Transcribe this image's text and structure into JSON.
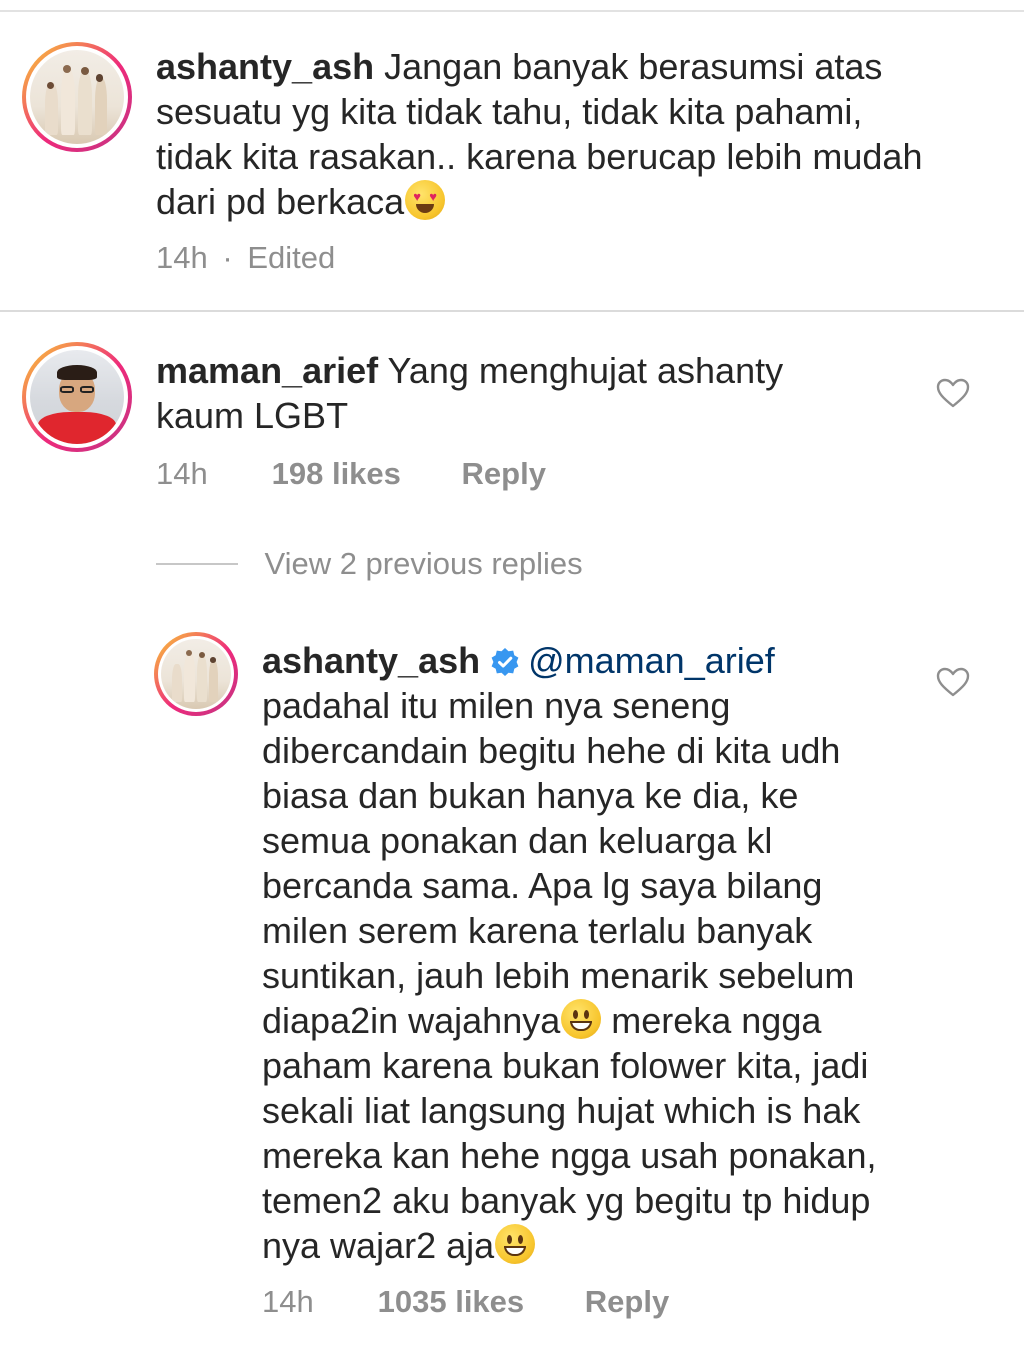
{
  "caption": {
    "username": "ashanty_ash",
    "text": "Jangan banyak berasumsi atas sesuatu yg kita tidak tahu, tidak kita pahami, tidak kita rasakan.. karena berucap lebih mudah dari pd berkaca",
    "emoji": "smiling-face-with-heart-eyes",
    "time": "14h",
    "separator": "·",
    "edited": "Edited"
  },
  "comment": {
    "username": "maman_arief",
    "text": "Yang menghujat ashanty kaum LGBT",
    "time": "14h",
    "likes": "198 likes",
    "reply_label": "Reply",
    "liked": false,
    "heart_icon": "heart-outline-icon"
  },
  "view_replies": {
    "label": "View 2 previous replies"
  },
  "reply": {
    "username": "ashanty_ash",
    "verified": true,
    "mention": "@maman_arief",
    "text_part1": "padahal itu milen nya seneng dibercandain begitu hehe di kita udh biasa dan bukan hanya ke dia, ke semua ponakan dan keluarga kl bercanda sama. Apa lg saya bilang milen serem karena terlalu banyak suntikan, jauh lebih menarik sebelum diapa2in wajahnya",
    "emoji1": "grinning-face",
    "text_part2": " mereka ngga paham karena bukan folower kita, jadi sekali liat langsung hujat which is hak mereka kan hehe ngga usah ponakan, temen2 aku banyak yg begitu tp hidup nya wajar2 aja",
    "emoji2": "grinning-face",
    "time": "14h",
    "likes": "1035 likes",
    "reply_label": "Reply",
    "liked": false,
    "heart_icon": "heart-outline-icon"
  },
  "colors": {
    "text": "#262626",
    "muted": "#8e8e8e",
    "mention": "#003569",
    "verified": "#3897f0",
    "divider": "#dbdbdb"
  }
}
